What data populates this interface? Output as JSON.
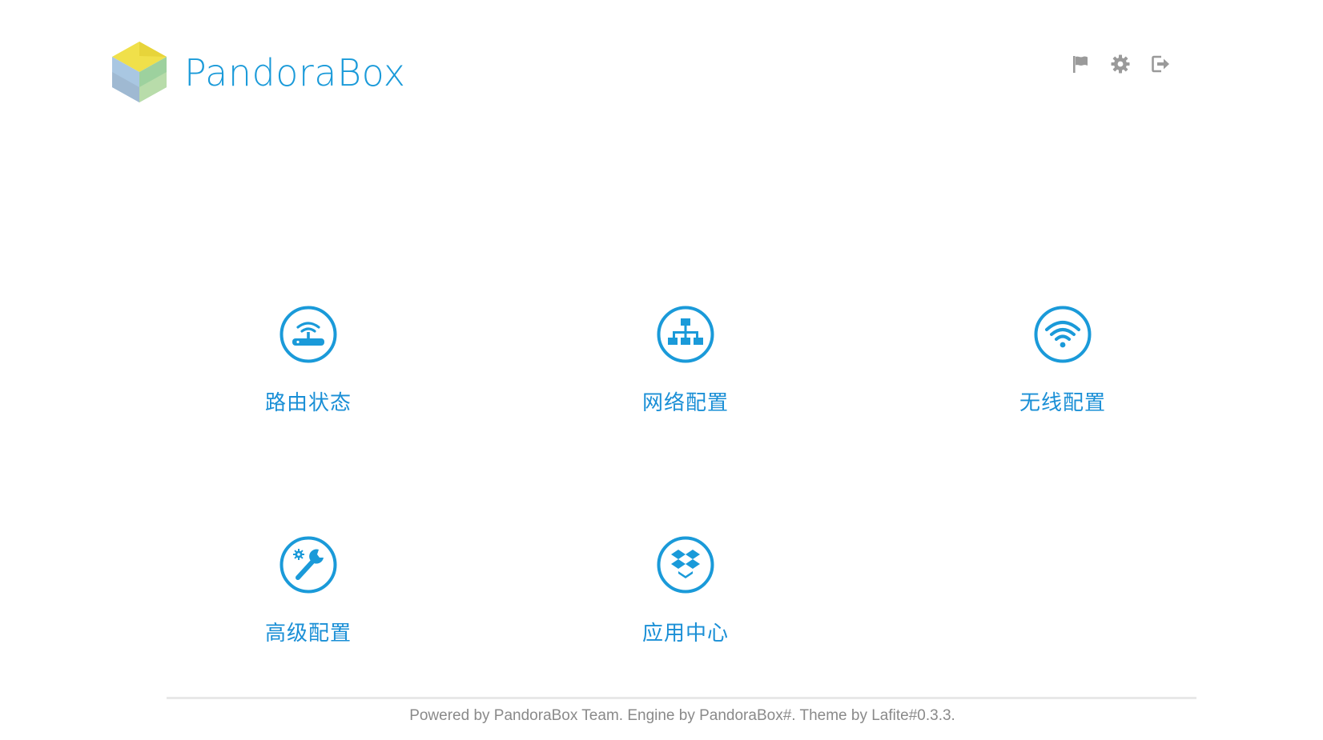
{
  "brand": {
    "name": "PandoraBox",
    "accent_color": "#1a9ad9",
    "logo_icon": "pandorabox-cube-logo"
  },
  "toolbar": {
    "items": [
      {
        "icon": "flag-icon",
        "label": ""
      },
      {
        "icon": "gear-icon",
        "label": ""
      },
      {
        "icon": "logout-icon",
        "label": ""
      }
    ]
  },
  "tiles": [
    {
      "label": "路由状态",
      "icon": "router-status-icon"
    },
    {
      "label": "网络配置",
      "icon": "network-tree-icon"
    },
    {
      "label": "无线配置",
      "icon": "wifi-icon"
    },
    {
      "label": "高级配置",
      "icon": "wrench-gear-icon"
    },
    {
      "label": "应用中心",
      "icon": "dropbox-apps-icon"
    }
  ],
  "footer": {
    "text": "Powered by PandoraBox Team. Engine by PandoraBox#. Theme by Lafite#0.3.3."
  }
}
